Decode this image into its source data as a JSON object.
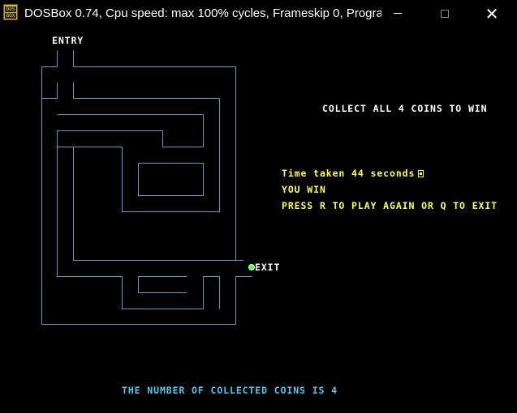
{
  "titlebar": {
    "title": "DOSBox 0.74, Cpu speed: max 100% cycles, Frameskip  0, Progra...",
    "app_icon_top": "DOS",
    "app_icon_bottom": "BOX"
  },
  "game": {
    "entry_label": "ENTRY",
    "goal_text": "COLLECT ALL 4 COINS TO WIN",
    "time_text": "Time taken 44 seconds",
    "win_text": "YOU WIN",
    "prompt_text": "PRESS R TO PLAY AGAIN OR Q TO EXIT",
    "exit_label": "EXIT",
    "coins_text": "THE NUMBER OF COLLECTED COINS IS 4",
    "colors": {
      "maze_wall": "#4aa3c7",
      "text": "#ffffff",
      "highlight": "#ffff55",
      "status": "#55c8f0",
      "player": "#55ff55"
    }
  }
}
